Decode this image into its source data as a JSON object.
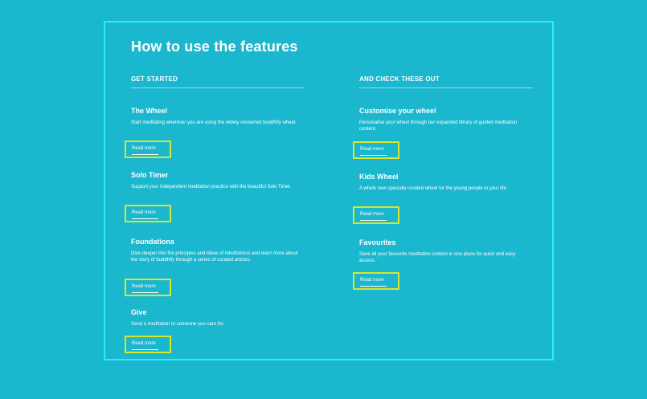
{
  "page": {
    "title": "How to use the features",
    "accent_color": "#26f1f7",
    "highlight_color": "#d7e82a",
    "background_color": "#1ab7cf"
  },
  "left_column": {
    "heading": "GET STARTED",
    "features": [
      {
        "title": "The Wheel",
        "description": "Start meditating wherever you are using the widely renowned buddhify wheel.",
        "link": "Read more"
      },
      {
        "title": "Solo Timer",
        "description": "Support your independent meditation practice with the beautiful Solo Timer.",
        "link": "Read more"
      },
      {
        "title": "Foundations",
        "description": "Dive deeper into the principles and ideas of mindfulness and learn more about the story of buddhify through a series of curated articles.",
        "link": "Read more"
      },
      {
        "title": "Give",
        "description": "Send a meditation to someone you care for.",
        "link": "Read more"
      }
    ]
  },
  "right_column": {
    "heading": "AND CHECK THESE OUT",
    "features": [
      {
        "title": "Customise your wheel",
        "description": "Personalise your wheel through our expanded library of guided meditation content.",
        "link": "Read more"
      },
      {
        "title": "Kids Wheel",
        "description": "A whole new specially curated wheel for the young people in your life.",
        "link": "Read more"
      },
      {
        "title": "Favourites",
        "description": "Save all your favourite meditation content in one place for quick and easy access.",
        "link": "Read more"
      }
    ]
  }
}
